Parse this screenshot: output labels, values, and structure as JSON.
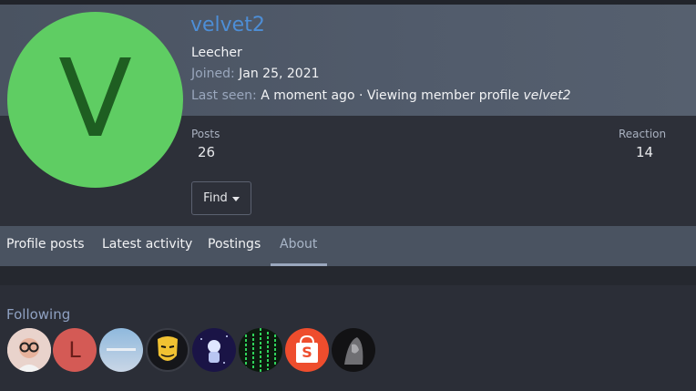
{
  "profile": {
    "avatar_letter": "V",
    "username": "velvet2",
    "user_title": "Leecher",
    "joined_label": "Joined:",
    "joined_value": "Jan 25, 2021",
    "last_seen_label": "Last seen:",
    "last_seen_value": "A moment ago · Viewing member profile",
    "last_seen_target": "velvet2"
  },
  "stats": {
    "posts_label": "Posts",
    "posts_value": "26",
    "reaction_label": "Reaction",
    "reaction_value": "14"
  },
  "find_button": {
    "label": "Find"
  },
  "tabs": [
    {
      "label": "Profile posts"
    },
    {
      "label": "Latest activity"
    },
    {
      "label": "Postings"
    },
    {
      "label": "About",
      "active": true
    }
  ],
  "following": {
    "title": "Following",
    "avatars": [
      {
        "icon": "user-photo-icon",
        "letter": ""
      },
      {
        "icon": "letter-avatar",
        "letter": "L"
      },
      {
        "icon": "user-photo-icon",
        "letter": ""
      },
      {
        "icon": "mask-icon",
        "letter": ""
      },
      {
        "icon": "astronaut-icon",
        "letter": ""
      },
      {
        "icon": "matrix-code-icon",
        "letter": ""
      },
      {
        "icon": "shopping-bag-icon",
        "letter": "S"
      },
      {
        "icon": "dark-figure-icon",
        "letter": ""
      }
    ]
  },
  "colors": {
    "username": "#4d8ed6",
    "avatar_bg": "#5fcd63",
    "header_bg": "#4a5361",
    "page_bg": "#2b2e37"
  }
}
